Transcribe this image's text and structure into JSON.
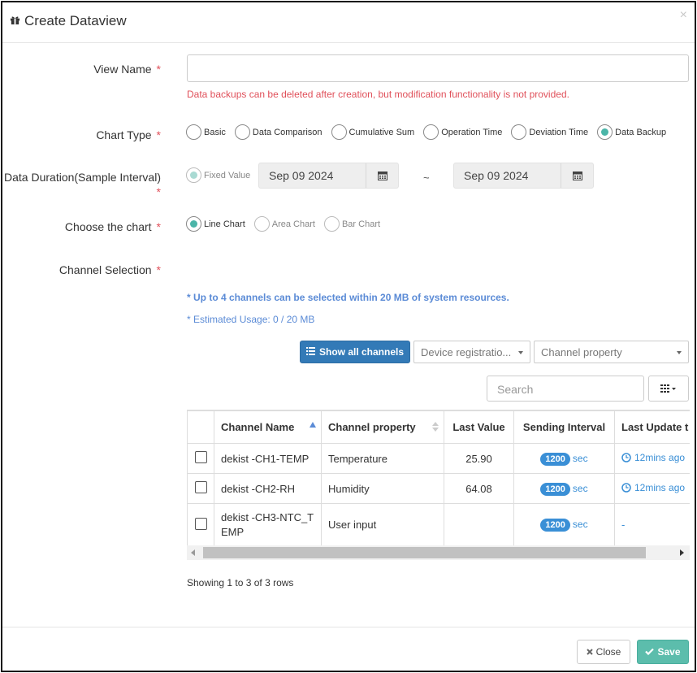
{
  "dialog": {
    "title": "Create Dataview",
    "close_glyph": "×"
  },
  "form": {
    "view_name": {
      "label": "View Name",
      "required": "*",
      "value": ""
    },
    "warning": "Data backups can be deleted after creation, but modification functionality is not provided.",
    "chart_type": {
      "label": "Chart Type",
      "required": "*",
      "options": [
        "Basic",
        "Data Comparison",
        "Cumulative Sum",
        "Operation Time",
        "Deviation Time",
        "Data Backup"
      ],
      "selected": "Data Backup"
    },
    "data_duration": {
      "label": "Data Duration(Sample Interval)",
      "required": "*",
      "option": "Fixed Value",
      "start_date": "Sep 09 2024",
      "separator": "~",
      "end_date": "Sep 09 2024"
    },
    "choose_chart": {
      "label": "Choose the chart",
      "required": "*",
      "options": [
        "Line Chart",
        "Area Chart",
        "Bar Chart"
      ],
      "selected": "Line Chart"
    },
    "channel_selection": {
      "label": "Channel Selection",
      "required": "*",
      "info1": "* Up to 4 channels can be selected within 20 MB of system resources.",
      "info2": "* Estimated Usage: 0 / 20 MB"
    }
  },
  "toolbar": {
    "show_all_label": "Show all channels",
    "device_filter": "Device registratio...",
    "property_filter": "Channel property",
    "search_placeholder": "Search"
  },
  "table": {
    "columns": [
      "Channel Name",
      "Channel property",
      "Last Value",
      "Sending Interval",
      "Last Update t"
    ],
    "rows": [
      {
        "name": "dekist -CH1-TEMP",
        "property": "Temperature",
        "last_value": "25.90",
        "interval": "1200",
        "unit": "sec",
        "last_update": "12mins ago"
      },
      {
        "name": "dekist -CH2-RH",
        "property": "Humidity",
        "last_value": "64.08",
        "interval": "1200",
        "unit": "sec",
        "last_update": "12mins ago"
      },
      {
        "name": "dekist -CH3-NTC_TEMP",
        "property": "User input",
        "last_value": "",
        "interval": "1200",
        "unit": "sec",
        "last_update": "-"
      }
    ],
    "showing": "Showing 1 to 3 of 3 rows"
  },
  "footer": {
    "close_label": "Close",
    "save_label": "Save"
  },
  "colors": {
    "accent": "#5cbdac",
    "primary": "#337ab7",
    "required": "#e0505a",
    "info": "#5b8bd6"
  }
}
